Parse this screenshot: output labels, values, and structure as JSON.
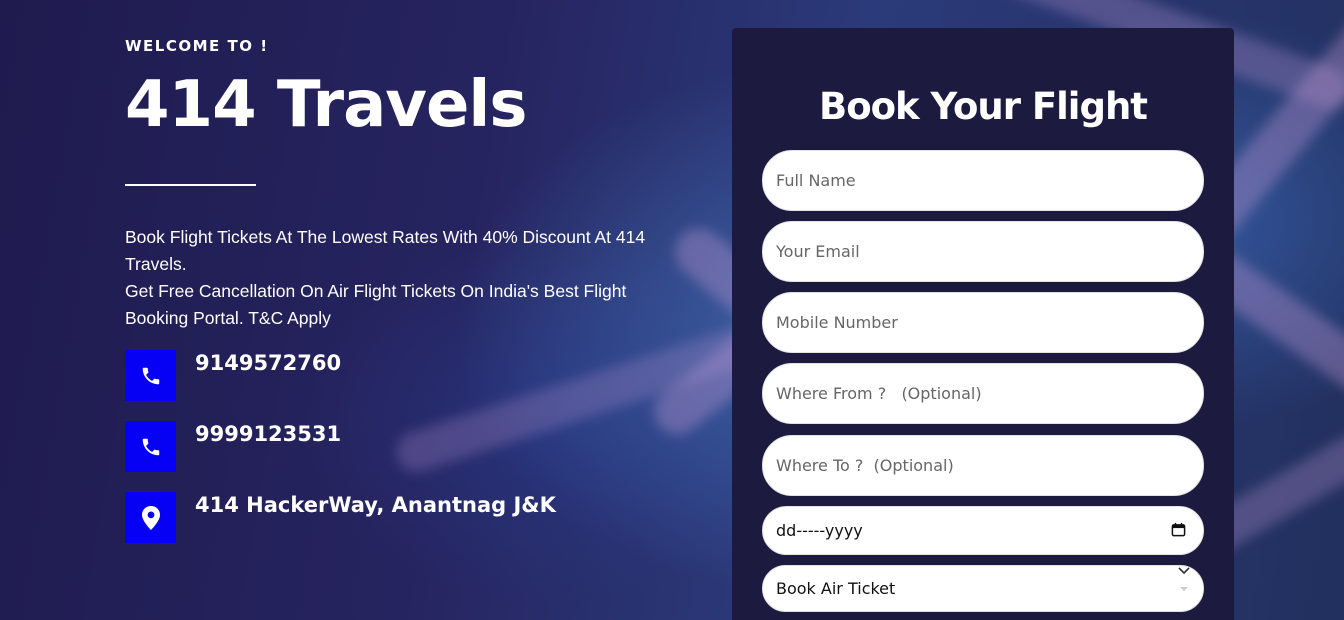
{
  "hero": {
    "welcome": "WELCOME TO !",
    "brand": "414 Travels",
    "description_line1": "Book Flight Tickets At The Lowest Rates With 40% Discount At 414 Travels.",
    "description_line2": "Get Free Cancellation On Air Flight Tickets On India's Best Flight Booking Portal. T&C Apply"
  },
  "contacts": [
    {
      "icon": "phone-icon",
      "text": "9149572760"
    },
    {
      "icon": "phone-icon",
      "text": "9999123531"
    },
    {
      "icon": "location-pin-icon",
      "text": "414 HackerWay, Anantnag J&K"
    }
  ],
  "form": {
    "title": "Book Your Flight",
    "full_name_placeholder": "Full Name",
    "email_placeholder": "Your Email",
    "mobile_placeholder": "Mobile Number",
    "from_placeholder": "Where From ?   (Optional)",
    "to_placeholder": "Where To ?  (Optional)",
    "date_value": "dd-----yyyy",
    "service_selected": "Book Air Ticket"
  },
  "colors": {
    "icon_bg": "#0600f5",
    "panel_bg": "#1d1a40",
    "page_bg": "#231f54"
  }
}
